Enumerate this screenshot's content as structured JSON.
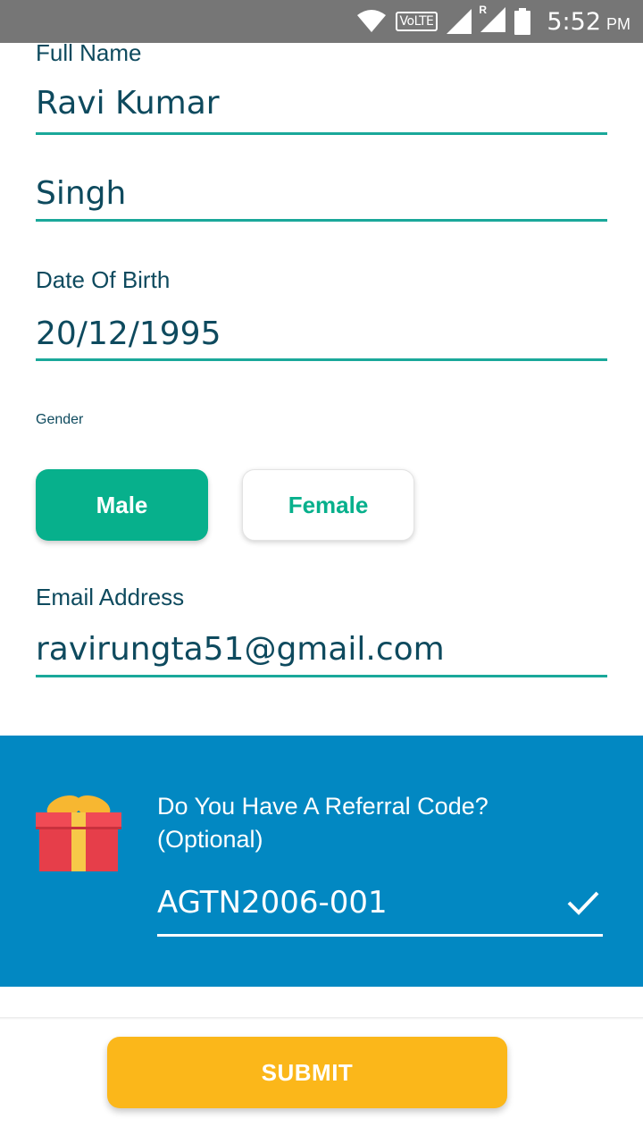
{
  "status_bar": {
    "network_label": "VoLTE",
    "roaming_label": "R",
    "time": "5:52",
    "ampm": "PM",
    "icons": [
      "wifi-icon",
      "volte-icon",
      "signal-icon",
      "roaming-signal-icon",
      "battery-icon"
    ]
  },
  "form": {
    "full_name": {
      "label": "Full Name",
      "value": "Ravi Kumar"
    },
    "last_name": {
      "value": "Singh"
    },
    "dob": {
      "label": "Date Of Birth",
      "value": "20/12/1995"
    },
    "gender": {
      "label": "Gender",
      "options": [
        "Male",
        "Female"
      ],
      "selected": "Male"
    },
    "email": {
      "label": "Email Address",
      "value": "ravirungta51@gmail.com"
    }
  },
  "referral": {
    "question": "Do You Have A Referral Code?",
    "optional": "(Optional)",
    "code": "AGTN2006-001",
    "icon": "gift-icon",
    "status_icon": "checkmark-icon"
  },
  "submit_label": "SUBMIT",
  "colors": {
    "status_bar": "#767676",
    "primary_text": "#0e4a5e",
    "underline": "#1aa89a",
    "selected_green": "#07b08c",
    "referral_blue": "#0288c2",
    "submit_yellow": "#fbb71a"
  }
}
